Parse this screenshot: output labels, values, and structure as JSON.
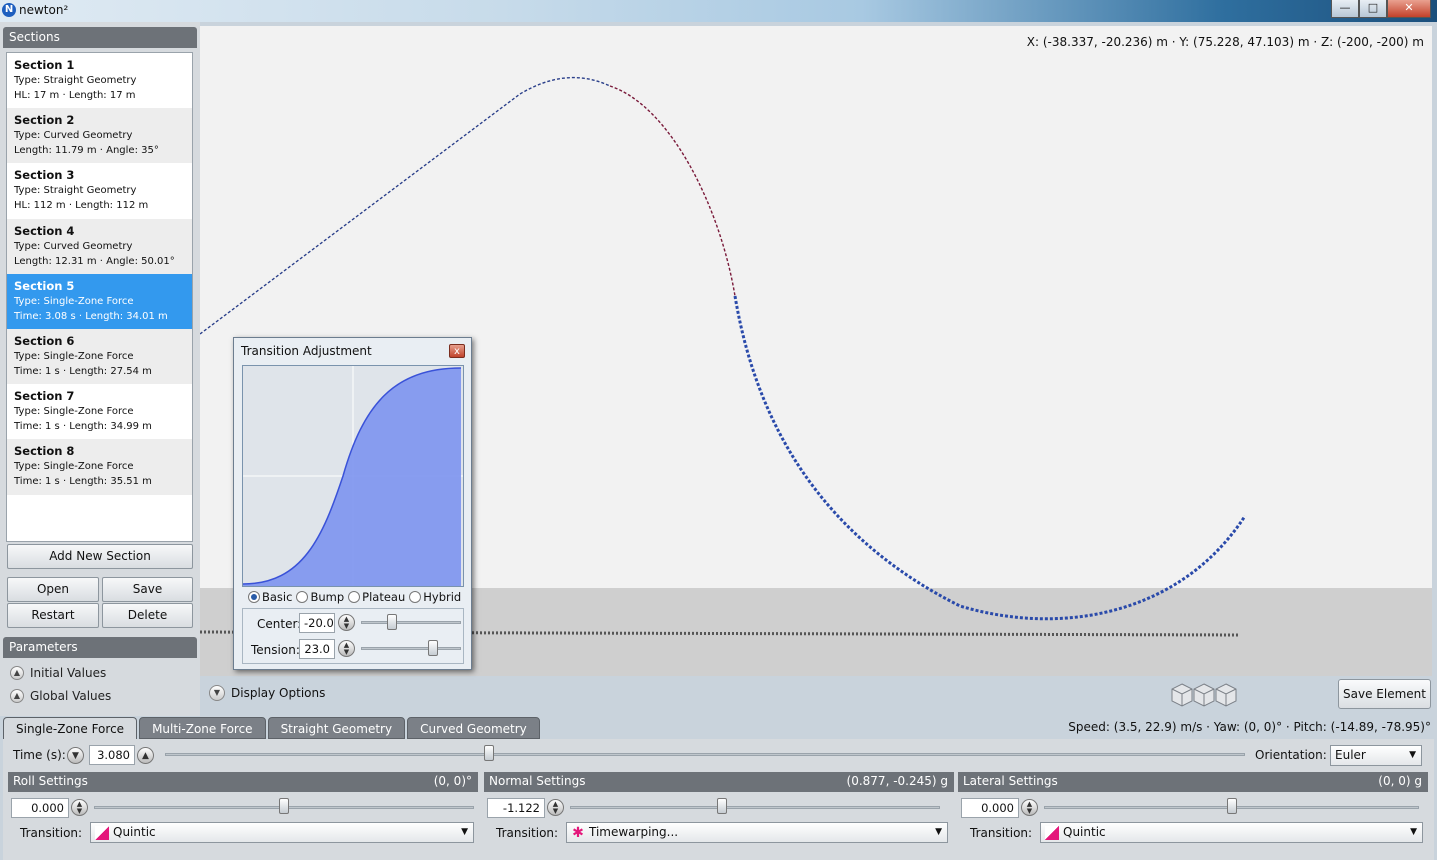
{
  "window": {
    "title": "newton²",
    "app_icon_letter": "N",
    "minimize": "—",
    "maximize": "□",
    "close": "✕"
  },
  "sections_panel": {
    "header": "Sections",
    "items": [
      {
        "name": "Section 1",
        "type": "Type: Straight Geometry",
        "detail": "HL: 17 m · Length: 17 m",
        "selected": false
      },
      {
        "name": "Section 2",
        "type": "Type: Curved Geometry",
        "detail": "Length: 11.79 m · Angle: 35°",
        "selected": false
      },
      {
        "name": "Section 3",
        "type": "Type: Straight Geometry",
        "detail": "HL: 112 m · Length: 112 m",
        "selected": false
      },
      {
        "name": "Section 4",
        "type": "Type: Curved Geometry",
        "detail": "Length: 12.31 m · Angle: 50.01°",
        "selected": false
      },
      {
        "name": "Section 5",
        "type": "Type: Single-Zone Force",
        "detail": "Time: 3.08 s · Length: 34.01 m",
        "selected": true
      },
      {
        "name": "Section 6",
        "type": "Type: Single-Zone Force",
        "detail": "Time: 1 s · Length: 27.54 m",
        "selected": false
      },
      {
        "name": "Section 7",
        "type": "Type: Single-Zone Force",
        "detail": "Time: 1 s · Length: 34.99 m",
        "selected": false
      },
      {
        "name": "Section 8",
        "type": "Type: Single-Zone Force",
        "detail": "Time: 1 s · Length: 35.51 m",
        "selected": false
      }
    ],
    "buttons": {
      "add": "Add New Section",
      "open": "Open",
      "save": "Save",
      "restart": "Restart",
      "delete": "Delete"
    }
  },
  "parameters_panel": {
    "header": "Parameters",
    "items": [
      "Initial Values",
      "Global Values"
    ]
  },
  "viewport": {
    "coords": "X: (-38.337, -20.236) m  ·  Y: (75.228, 47.103) m  ·  Z: (-200, -200) m"
  },
  "transition_dialog": {
    "title": "Transition Adjustment",
    "close": "x",
    "modes": [
      "Basic",
      "Bump",
      "Plateau",
      "Hybrid"
    ],
    "selected_mode": "Basic",
    "center_label": "Center:",
    "center_value": "-20.0",
    "center_slider_fraction": 0.31,
    "tension_label": "Tension:",
    "tension_value": "23.0",
    "tension_slider_fraction": 0.72
  },
  "toolbar": {
    "display_options": "Display Options",
    "save_element": "Save Element"
  },
  "tabs": [
    "Single-Zone Force",
    "Multi-Zone Force",
    "Straight Geometry",
    "Curved Geometry"
  ],
  "status": "Speed: (3.5, 22.9) m/s · Yaw: (0, 0)° · Pitch: (-14.89, -78.95)°",
  "time": {
    "label": "Time (s):",
    "value": "3.080",
    "slider_fraction": 0.3
  },
  "orientation": {
    "label": "Orientation:",
    "value": "Euler"
  },
  "roll": {
    "header": "Roll Settings",
    "range": "(0, 0)°",
    "value": "0.000",
    "slider_fraction": 0.5,
    "transition_label": "Transition:",
    "transition": "Quintic"
  },
  "normal": {
    "header": "Normal Settings",
    "range": "(0.877, -0.245) g",
    "value": "-1.122",
    "slider_fraction": 0.41,
    "transition_label": "Transition:",
    "transition": "Timewarping..."
  },
  "lateral": {
    "header": "Lateral Settings",
    "range": "(0, 0) g",
    "value": "0.000",
    "slider_fraction": 0.5,
    "transition_label": "Transition:",
    "transition": "Quintic"
  }
}
